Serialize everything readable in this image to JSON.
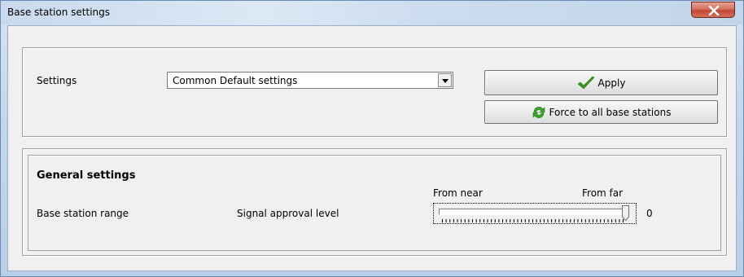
{
  "window": {
    "title": "Base station settings",
    "close_icon": "close-x-icon"
  },
  "settings_group": {
    "label": "Settings",
    "combo": {
      "selected": "Common Default settings",
      "arrow_icon": "dropdown-arrow-icon"
    },
    "apply_button": {
      "label": "Apply",
      "icon": "checkmark-icon",
      "icon_color": "#3a9a1e"
    },
    "force_button": {
      "label": "Force to all base stations",
      "icon": "refresh-icon",
      "icon_color": "#3aa52a"
    }
  },
  "general_group": {
    "heading": "General settings",
    "range_label": "Base station range",
    "signal_label": "Signal approval level",
    "slider": {
      "left_label": "From near",
      "right_label": "From far",
      "value": "0",
      "position_fraction": 1.0
    }
  },
  "colors": {
    "title_bar": "#c9daee",
    "close_button": "#c24832",
    "dialog_bg": "#f0f0f0"
  }
}
